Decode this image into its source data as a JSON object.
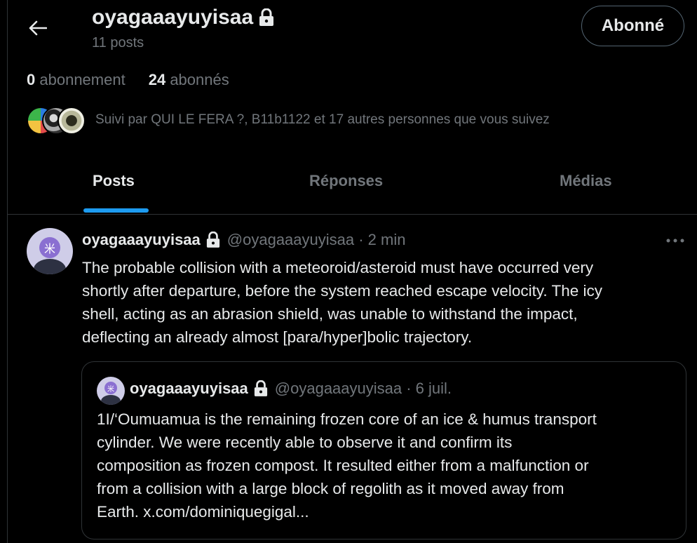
{
  "header": {
    "title": "oyagaaayuyisaa",
    "posts_count": "11 posts",
    "follow_label": "Abonné"
  },
  "stats": {
    "following_count": "0",
    "following_label": "abonnement",
    "followers_count": "24",
    "followers_label": "abonnés"
  },
  "followed_by": "Suivi par QUI LE FERA ?, B11b1122 et 17 autres personnes que vous suivez",
  "tabs": [
    {
      "label": "Posts",
      "active": true
    },
    {
      "label": "Réponses",
      "active": false
    },
    {
      "label": "Médias",
      "active": false
    }
  ],
  "post": {
    "name": "oyagaaayuyisaa",
    "meta": "@oyagaaayuyisaa · 2 min",
    "text": "The probable collision with a meteoroid/asteroid must have occurred very\nshortly after departure, before the system reached escape velocity. The icy\nshell, acting as an abrasion shield, was unable to withstand the impact,\ndeflecting an already almost [para/hyper]bolic trajectory.",
    "quote": {
      "name": "oyagaaayuyisaa",
      "meta": "@oyagaaayuyisaa · 6 juil.",
      "text": "1I/‘Oumuamua is the remaining frozen core of an ice & humus transport\ncylinder. We were recently able to observe it and confirm its\ncomposition as frozen compost. It resulted either from a malfunction or\nfrom a collision with a large block of regolith as it moved away from\nEarth. x.com/dominiquegigal..."
    }
  },
  "colors": {
    "background": "#000000",
    "text": "#e7e9ea",
    "muted": "#71767b",
    "accent": "#1d9bf0",
    "border": "#2f3336"
  },
  "icons": {
    "back": "arrow-left-icon",
    "lock": "lock-icon",
    "more": "more-horizontal-icon"
  }
}
